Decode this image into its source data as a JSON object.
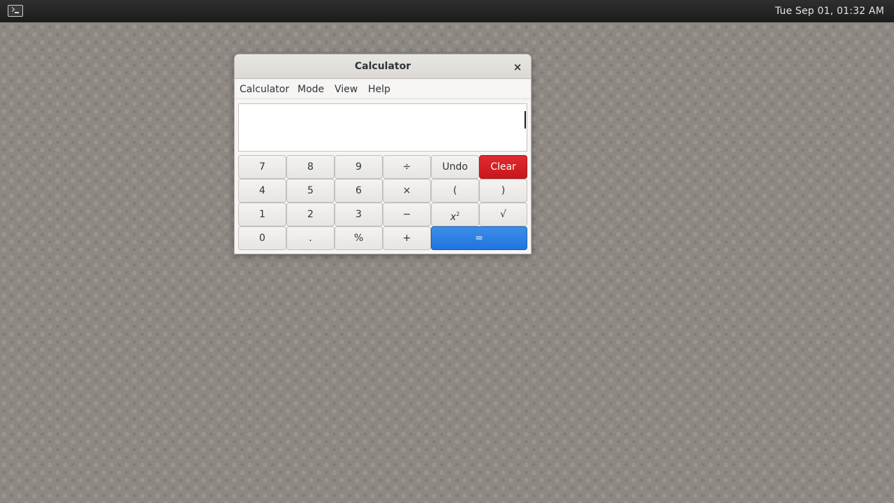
{
  "topbar": {
    "clock": "Tue Sep 01, 01:32 AM",
    "app_icon": "terminal-icon"
  },
  "window": {
    "title": "Calculator",
    "close_glyph": "×",
    "menu": [
      "Calculator",
      "Mode",
      "View",
      "Help"
    ],
    "display": {
      "value": ""
    },
    "keys": {
      "r1": [
        "7",
        "8",
        "9",
        "÷",
        "Undo",
        "Clear"
      ],
      "r2": [
        "4",
        "5",
        "6",
        "×",
        "(",
        ")"
      ],
      "r3": [
        "1",
        "2",
        "3",
        "−",
        "x",
        "√"
      ],
      "r3_superscript": "2",
      "r4": [
        "0",
        ".",
        "%",
        "+",
        "="
      ]
    }
  },
  "colors": {
    "clear_button": "#c7171c",
    "equals_button": "#1f74de",
    "desktop": "#8e8883"
  }
}
